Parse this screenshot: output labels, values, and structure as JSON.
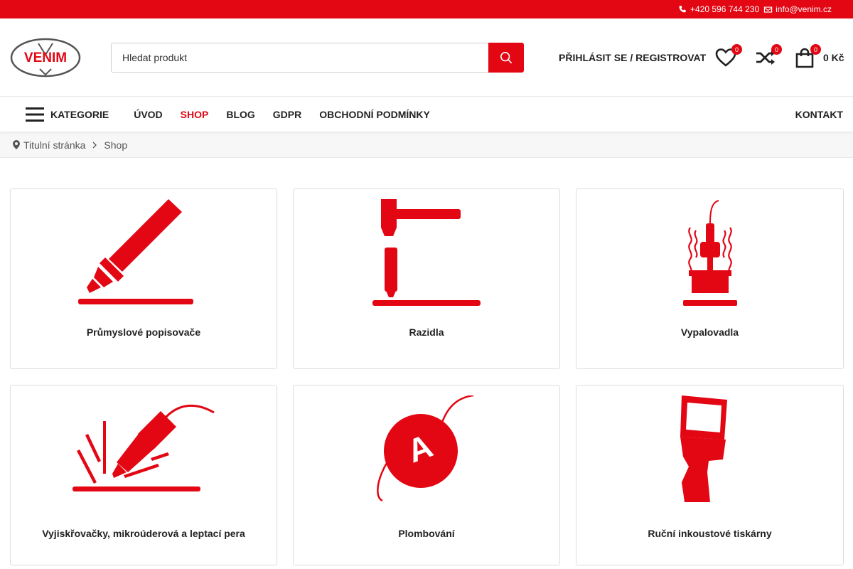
{
  "topbar": {
    "phone": "+420 596 744 230",
    "email": "info@venim.cz"
  },
  "header": {
    "logo_text": "VENIM",
    "search_placeholder": "Hledat produkt",
    "login_label": "PŘIHLÁSIT SE / REGISTROVAT",
    "wishlist_count": "0",
    "compare_count": "0",
    "cart_count": "0",
    "cart_total": "0 Kč"
  },
  "nav": {
    "categories_label": "KATEGORIE",
    "links": [
      "ÚVOD",
      "SHOP",
      "BLOG",
      "GDPR",
      "OBCHODNÍ PODMÍNKY"
    ],
    "active": "SHOP",
    "contact": "KONTAKT"
  },
  "breadcrumb": {
    "home": "Titulní stránka",
    "current": "Shop"
  },
  "categories": [
    {
      "title": "Průmyslové popisovače",
      "icon": "marker-icon"
    },
    {
      "title": "Razidla",
      "icon": "stamp-press-icon"
    },
    {
      "title": "Vypalovadla",
      "icon": "hot-stamp-icon"
    },
    {
      "title": "Vyjiskřovačky, mikroúderová a leptací pera",
      "icon": "engraving-pen-icon"
    },
    {
      "title": "Plombování",
      "icon": "seal-icon"
    },
    {
      "title": "Ruční inkoustové tiskárny",
      "icon": "handheld-printer-icon"
    }
  ],
  "colors": {
    "accent": "#e30613",
    "text": "#222222",
    "border": "#dedede"
  }
}
